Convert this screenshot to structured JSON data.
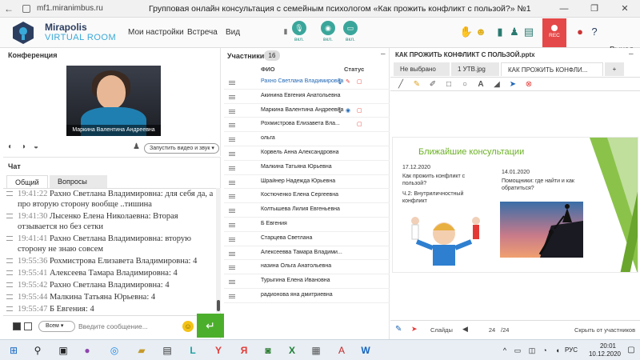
{
  "browser": {
    "url": "mf1.miranimbus.ru",
    "page_title": "Групповая онлайн консультация с семейным психологом «Как прожить конфликт с пользой?» №1"
  },
  "topbar": {
    "logo_line1": "Mirapolis",
    "logo_line2": "VIRTUAL ROOM",
    "menu": [
      "Мои настройки",
      "Встреча",
      "Вид"
    ],
    "mic_label": "вкл.",
    "cam_label": "вкл.",
    "screen_label": "вкл.",
    "rec_label": "REC",
    "exit_label": "Выход",
    "accent_color": "#3aa69b"
  },
  "conference": {
    "title": "Конференция",
    "video_caption": "Маркина Валентина Андреевна",
    "start_video_label": "Запустить видео и звук"
  },
  "chat": {
    "title": "Чат",
    "tabs": [
      "Общий",
      "Вопросы"
    ],
    "messages": [
      {
        "time": "19:41:22",
        "author": "Рахно Светлана Владимировна",
        "text": "для себя да, а про вторую сторону вообще ..тишина"
      },
      {
        "time": "19:41:30",
        "author": "Лысенко Елена Николаевна",
        "text": "Вторая отзывается но без сетки"
      },
      {
        "time": "19:41:41",
        "author": "Рахно Светлана Владимировна",
        "text": "вторую сторону не знаю совсем"
      },
      {
        "time": "19:55:36",
        "author": "Рохмистрова Елизавета Владимировна",
        "text": "4"
      },
      {
        "time": "19:55:41",
        "author": "Алексеева Тамара Владимировна",
        "text": "4"
      },
      {
        "time": "19:55:42",
        "author": "Рахно Светлана Владимировна",
        "text": "4"
      },
      {
        "time": "19:55:44",
        "author": "Малкина Татьяна Юрьевна",
        "text": "4"
      },
      {
        "time": "19:55:47",
        "author": "Б Евгения",
        "text": "4"
      }
    ],
    "to_all_label": "Всем",
    "input_placeholder": "Введите сообщение...",
    "send_color": "#4caf2c"
  },
  "participants": {
    "title": "Участники",
    "count": "16",
    "col_name": "ФИО",
    "col_status": "Статус",
    "rows": [
      {
        "name": "Рахно Светлана Владимировна"
      },
      {
        "name": "Акинина Евгения Анатольевна"
      },
      {
        "name": "Маркина Валентина Андреевна"
      },
      {
        "name": "Рохмистрова Елизавета Вла..."
      },
      {
        "name": "ольга"
      },
      {
        "name": "Корвель Анна Александровна"
      },
      {
        "name": "Малкина Татьяна Юрьевна"
      },
      {
        "name": "Шрайнер Надежда Юрьевна"
      },
      {
        "name": "Костюченко Елена Сергеевна"
      },
      {
        "name": "Колтышева Лилия Евгеньевна"
      },
      {
        "name": "Б Евгения"
      },
      {
        "name": "Старцева Светлана"
      },
      {
        "name": "Алексеевва Тамара Владими..."
      },
      {
        "name": "назина Ольга Анатольевна"
      },
      {
        "name": "Турыгина Елена Ивановна"
      },
      {
        "name": "радионова яна дмитриевна"
      }
    ]
  },
  "presentation": {
    "file_title": "КАК ПРОЖИТЬ КОНФЛИКТ С ПОЛЬЗОЙ.pptx",
    "tabs": [
      "Не выбрано",
      "1 УТВ.jpg",
      "КАК ПРОЖИТЬ КОНФЛИ..."
    ],
    "add_tab": "+",
    "slide": {
      "title": "Ближайшие консультации",
      "date1": "17.12.2020",
      "text1": "Как прожить конфликт с пользой?",
      "text2": "Ч.2: Внутриличностный конфликт",
      "date2": "14.01.2020",
      "text3": "Помощники: где найти и как обратиться?",
      "accent_color": "#6ab023"
    },
    "bottom": {
      "slides_label": "Слайды",
      "current": "24",
      "total": "/24",
      "hide_label": "Скрыть от участников"
    }
  },
  "taskbar": {
    "lang": "РУС",
    "time": "20:01",
    "date": "10.12.2020"
  }
}
